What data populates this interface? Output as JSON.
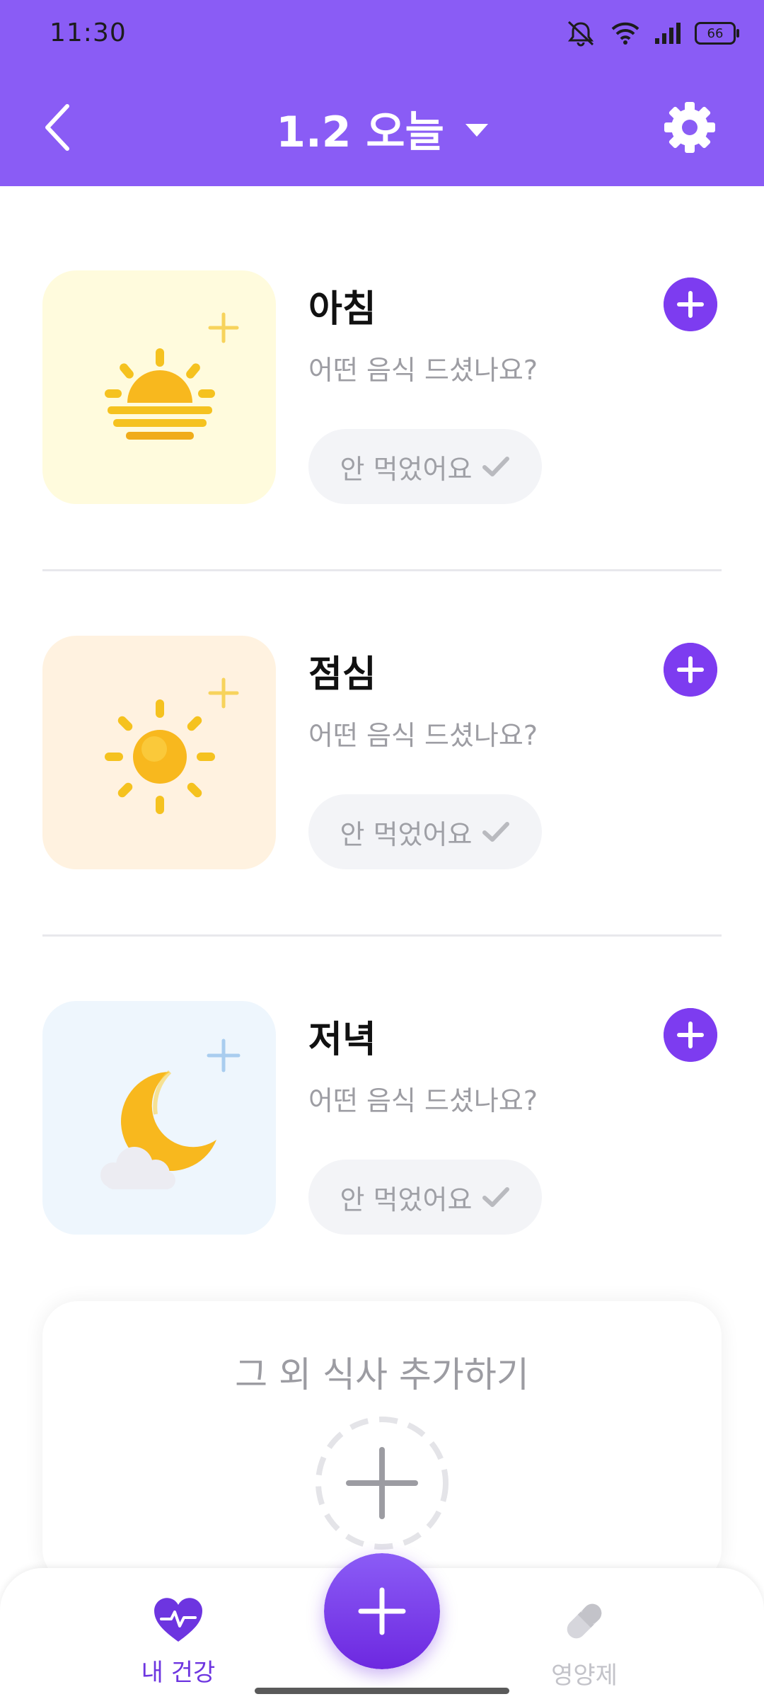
{
  "status_bar": {
    "time": "11:30",
    "battery": "66"
  },
  "header": {
    "title": "1.2 오늘"
  },
  "meals": [
    {
      "name": "아침",
      "question": "어떤 음식 드셨나요?",
      "skip_label": "안 먹었어요",
      "icon": "sunrise-icon",
      "bg": "#fffbdd"
    },
    {
      "name": "점심",
      "question": "어떤 음식 드셨나요?",
      "skip_label": "안 먹었어요",
      "icon": "sun-icon",
      "bg": "#fff2e0"
    },
    {
      "name": "저녁",
      "question": "어떤 음식 드셨나요?",
      "skip_label": "안 먹었어요",
      "icon": "moon-cloud-icon",
      "bg": "#eef6fd"
    }
  ],
  "extra_meal": {
    "title": "그 외 식사 추가하기"
  },
  "tabbar": {
    "health_label": "내 건강",
    "supplements_label": "영양제"
  },
  "colors": {
    "accent": "#7d3cf0",
    "header_bg": "#8a5cf5"
  }
}
